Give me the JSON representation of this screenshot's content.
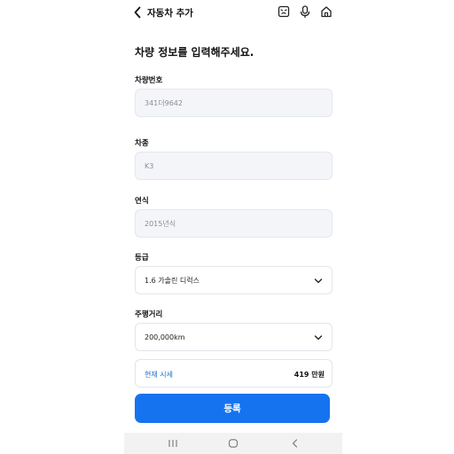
{
  "header": {
    "title": "자동차 추가",
    "back_icon": "chevron-left-icon",
    "icons": [
      "chat-icon",
      "microphone-icon",
      "home-icon"
    ]
  },
  "main": {
    "heading": "차량 정보를 입력해주세요.",
    "fields": [
      {
        "label": "차량번호",
        "value": "341더9642"
      },
      {
        "label": "차종",
        "value": "K3"
      },
      {
        "label": "연식",
        "value": "2015년식"
      },
      {
        "label": "등급",
        "value": "1.6 가솔린 디럭스"
      },
      {
        "label": "주행거리",
        "value": "200,000km"
      }
    ],
    "price": {
      "label": "현재 시세",
      "value": "419 만원"
    },
    "submit_label": "등록"
  },
  "colors": {
    "accent": "#1673f0",
    "price_label": "#1a73c8",
    "readonly_bg": "#f4f5f9"
  },
  "navbar": {
    "icons": [
      "recent-apps-icon",
      "home-button-icon",
      "back-nav-icon"
    ]
  }
}
